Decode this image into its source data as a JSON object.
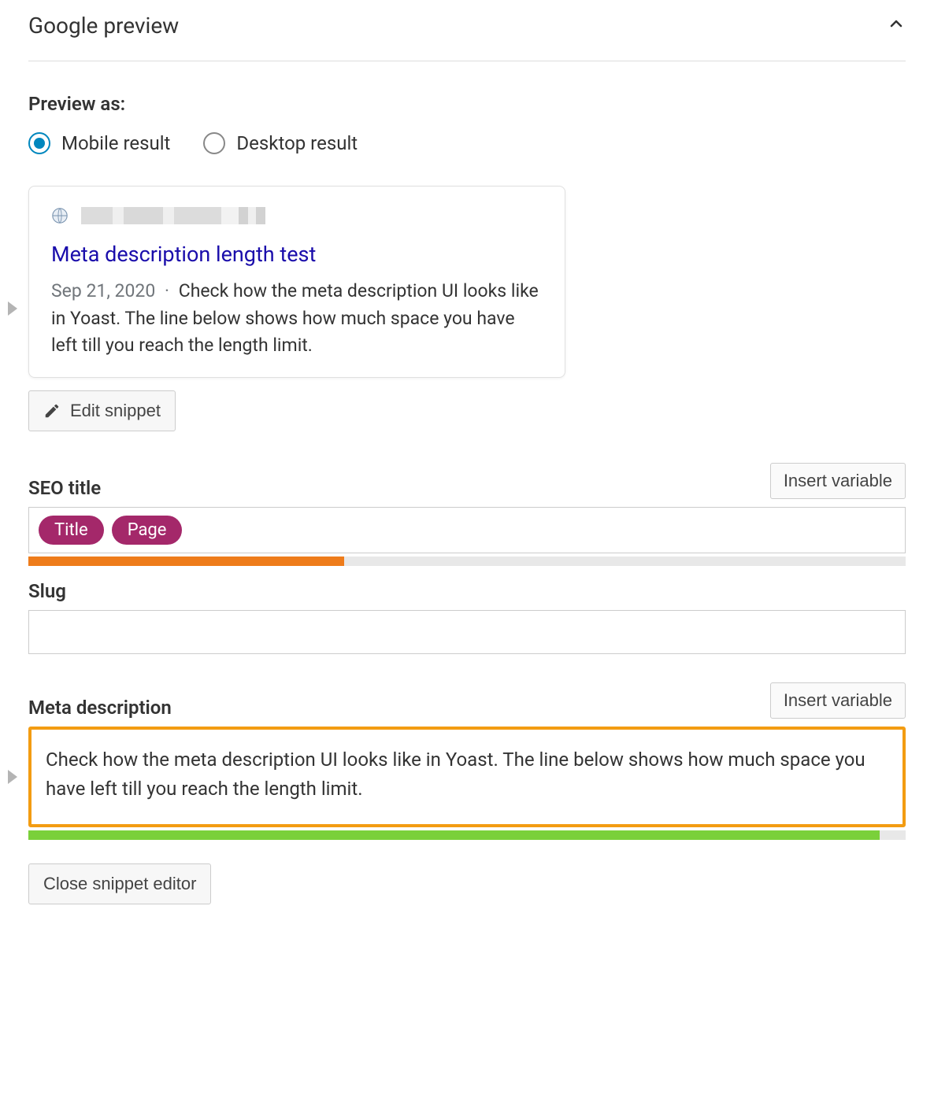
{
  "section": {
    "title": "Google preview"
  },
  "previewAs": {
    "label": "Preview as:",
    "options": [
      {
        "label": "Mobile result",
        "selected": true
      },
      {
        "label": "Desktop result",
        "selected": false
      }
    ]
  },
  "snippet": {
    "title": "Meta description length test",
    "date": "Sep 21, 2020",
    "separator": "·",
    "description": "Check how the meta description UI looks like in Yoast. The line below shows how much space you have left till you reach the length limit."
  },
  "editSnippet": {
    "label": "Edit snippet"
  },
  "seoTitle": {
    "label": "SEO title",
    "insertVariable": "Insert variable",
    "pills": [
      "Title",
      "Page"
    ],
    "progress": {
      "percent": 36,
      "color": "orange"
    }
  },
  "slug": {
    "label": "Slug",
    "value": ""
  },
  "metaDescription": {
    "label": "Meta description",
    "insertVariable": "Insert variable",
    "value": "Check how the meta description UI looks like in Yoast. The line below shows how much space you have left till you reach the length limit.",
    "progress": {
      "percent": 97,
      "color": "green"
    }
  },
  "closeEditor": {
    "label": "Close snippet editor"
  }
}
